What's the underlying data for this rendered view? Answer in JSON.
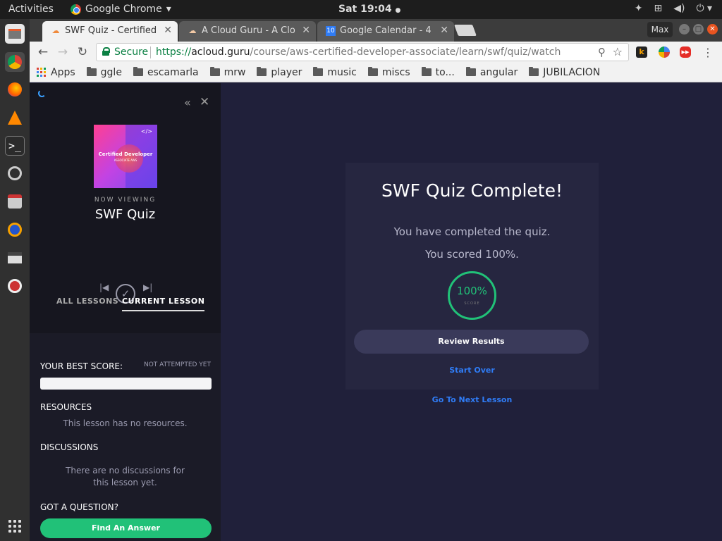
{
  "topbar": {
    "activities": "Activities",
    "app_name": "Google Chrome",
    "app_menu_arrow": "▾",
    "clock": "Sat 19:04",
    "clock_dot": "●",
    "tray_icons": [
      "dropbox-icon",
      "network-icon",
      "volume-icon",
      "power-icon"
    ]
  },
  "dock": {
    "items": [
      "files-icon",
      "chrome-icon",
      "firefox-icon",
      "vlc-icon",
      "terminal-icon",
      "updater-icon",
      "download-icon",
      "headphones-icon",
      "clapper-icon",
      "tools-icon"
    ]
  },
  "browser": {
    "tabs": [
      {
        "label": "SWF Quiz - Certified",
        "favicon": "cloud-icon",
        "active": true
      },
      {
        "label": "A Cloud Guru - A Clo",
        "favicon": "cloud-icon",
        "active": false
      },
      {
        "label": "Google Calendar - 4",
        "favicon": "calendar-icon",
        "favicon_text": "10",
        "active": false
      }
    ],
    "tab_close": "✕",
    "max_label": "Max",
    "secure_label": "Secure",
    "url_scheme": "https://",
    "url_host": "acloud.guru",
    "url_path": "/course/aws-certified-developer-associate/learn/swf/quiz/watch",
    "bookmarks": [
      {
        "label": "Apps",
        "type": "apps"
      },
      {
        "label": "ggle",
        "type": "folder"
      },
      {
        "label": "escamarla",
        "type": "folder"
      },
      {
        "label": "mrw",
        "type": "folder"
      },
      {
        "label": "player",
        "type": "folder"
      },
      {
        "label": "music",
        "type": "folder"
      },
      {
        "label": "miscs",
        "type": "folder"
      },
      {
        "label": "to...",
        "type": "folder"
      },
      {
        "label": "angular",
        "type": "folder"
      },
      {
        "label": "JUBILACION",
        "type": "folder"
      }
    ]
  },
  "sidebar": {
    "thumbnail_title": "Certified Developer",
    "thumbnail_subtitle": "ASSOCIATE AWS",
    "thumbnail_code": "</>",
    "now_viewing": "NOW VIEWING",
    "lesson_title": "SWF Quiz",
    "tab_all": "ALL LESSONS",
    "tab_current": "CURRENT LESSON",
    "best_score_heading": "YOUR BEST SCORE:",
    "not_attempted": "NOT ATTEMPTED YET",
    "resources_heading": "RESOURCES",
    "resources_msg": "This lesson has no resources.",
    "discussions_heading": "DISCUSSIONS",
    "discussions_msg": "There are no discussions for this lesson yet.",
    "question_heading": "GOT A QUESTION?",
    "find_answer": "Find An Answer"
  },
  "quiz": {
    "title": "SWF Quiz Complete!",
    "completed_msg": "You have completed the quiz.",
    "scored_msg": "You scored 100%.",
    "score_value": "100%",
    "score_label": "SCORE",
    "review_button": "Review Results",
    "start_over": "Start Over",
    "next_lesson": "Go To Next Lesson"
  },
  "colors": {
    "accent_green": "#21c178",
    "link_blue": "#2f7cf6",
    "page_bg": "#20203a",
    "sidebar_bg": "#16161f"
  }
}
